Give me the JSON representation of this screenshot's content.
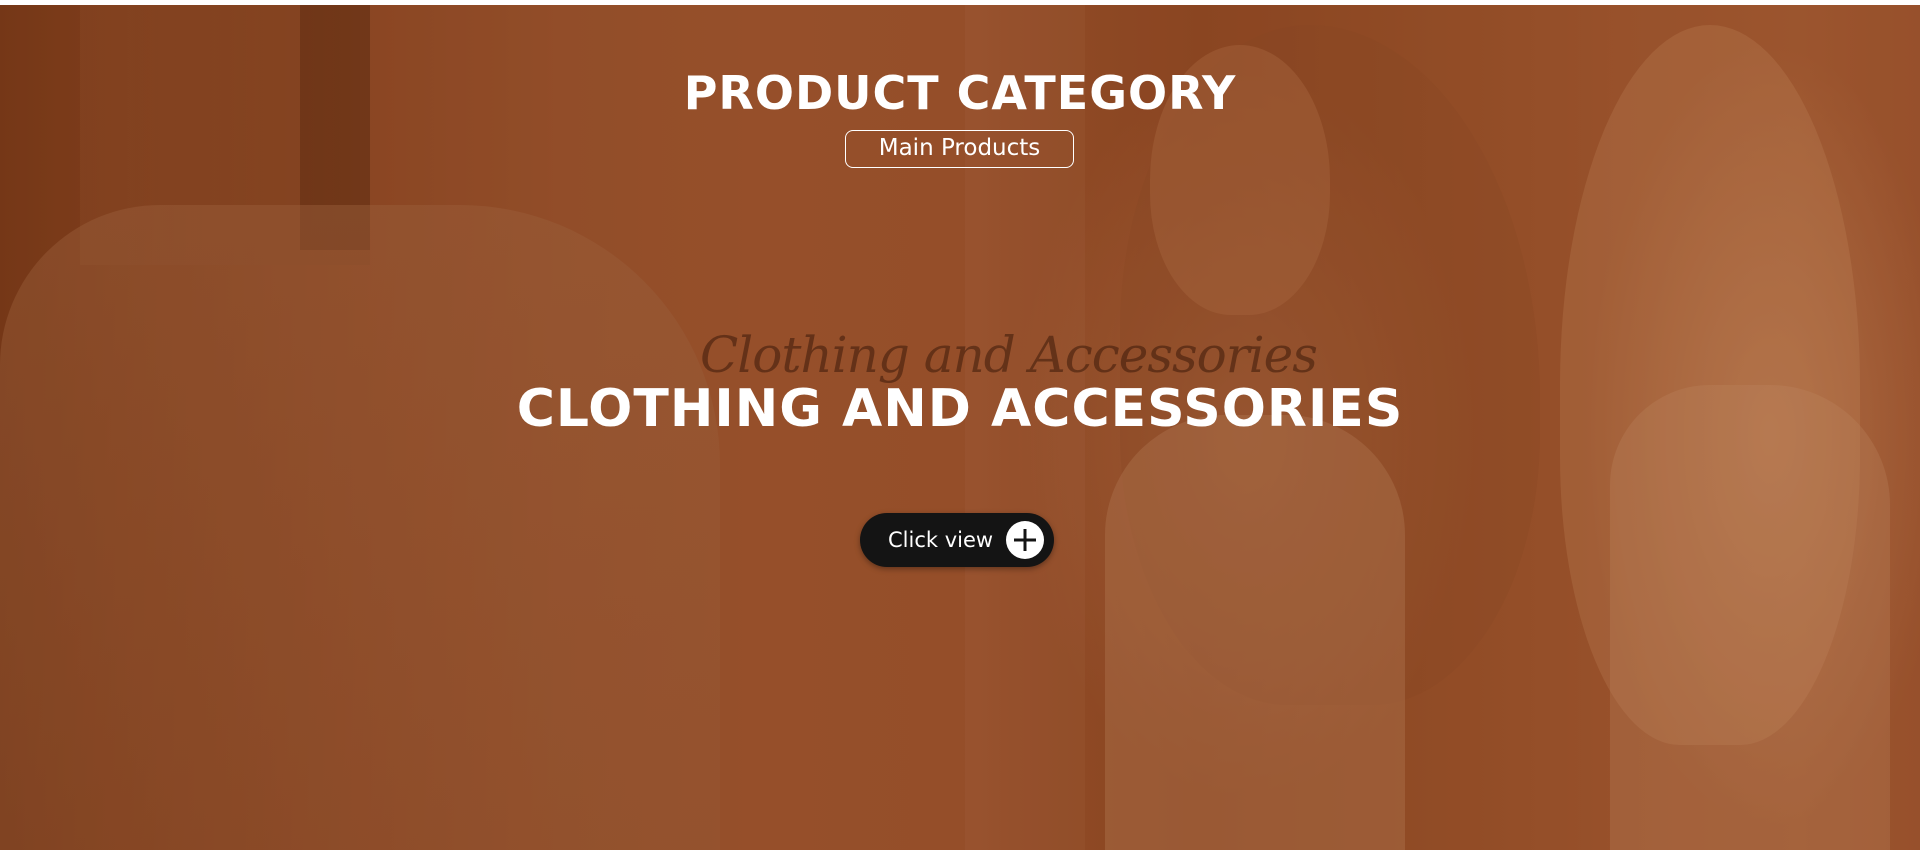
{
  "hero": {
    "section_title": "PRODUCT CATEGORY",
    "sub_tag": "Main Products",
    "script_text": "Clothing and Accessories",
    "main_heading": "CLOTHING AND ACCESSORIES",
    "cta": {
      "label": "Click view",
      "icon": "plus-icon"
    }
  },
  "colors": {
    "overlay": "#8c3e12",
    "button_bg": "#141414",
    "text": "#ffffff"
  }
}
